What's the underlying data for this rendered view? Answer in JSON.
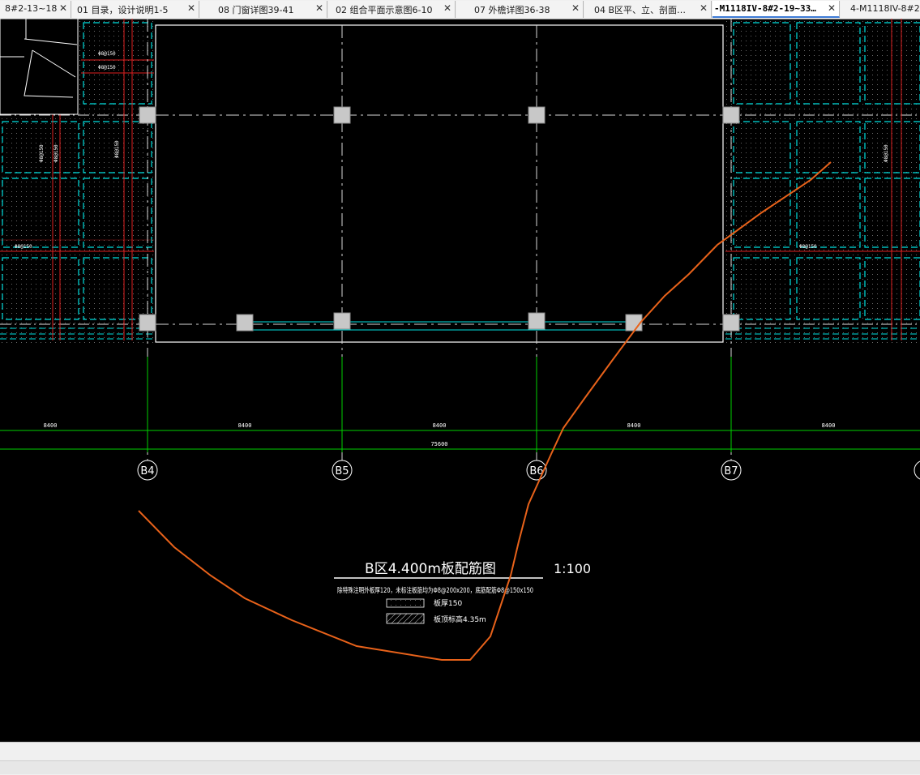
{
  "tabs": [
    {
      "label": "8#2-13~18…",
      "active": false
    },
    {
      "label": "01 目录，设计说明1-5",
      "active": false
    },
    {
      "label": "08 门窗详图39-41",
      "active": false
    },
    {
      "label": "02 组合平面示意图6-10",
      "active": false
    },
    {
      "label": "07 外檐详图36-38",
      "active": false
    },
    {
      "label": "04 B区平、立、剖面…",
      "active": false
    },
    {
      "label": "-M1118IV-8#2-19~33…",
      "active": true
    },
    {
      "label": "4-M1118IV-8#2-…",
      "active": false
    }
  ],
  "close_glyph": "✕",
  "drawing": {
    "axes": [
      "B4",
      "B5",
      "B6",
      "B7",
      "B"
    ],
    "span_dims": [
      "8400",
      "8400",
      "8400",
      "8400",
      "8400"
    ],
    "total_dim": "75600",
    "title": "B区4.400m板配筋图",
    "scale": "1:100",
    "note": "除特殊注明外板厚120，未标注板筋均为Φ8@200x200，底筋配筋Φ8@150x150",
    "legend_1": "板厚150",
    "legend_2": "板顶标高4.35m",
    "rebar_labels": [
      "Φ8@150",
      "Φ8@150",
      "Φ8@150",
      "Φ8@150",
      "Φ8@150",
      "Φ8@150",
      "Φ8@150",
      "Φ8@150"
    ]
  },
  "colors": {
    "cyan": "#00e0e0",
    "red": "#e02020",
    "green": "#00d000",
    "white": "#ffffff",
    "annotation": "#e8621a"
  }
}
